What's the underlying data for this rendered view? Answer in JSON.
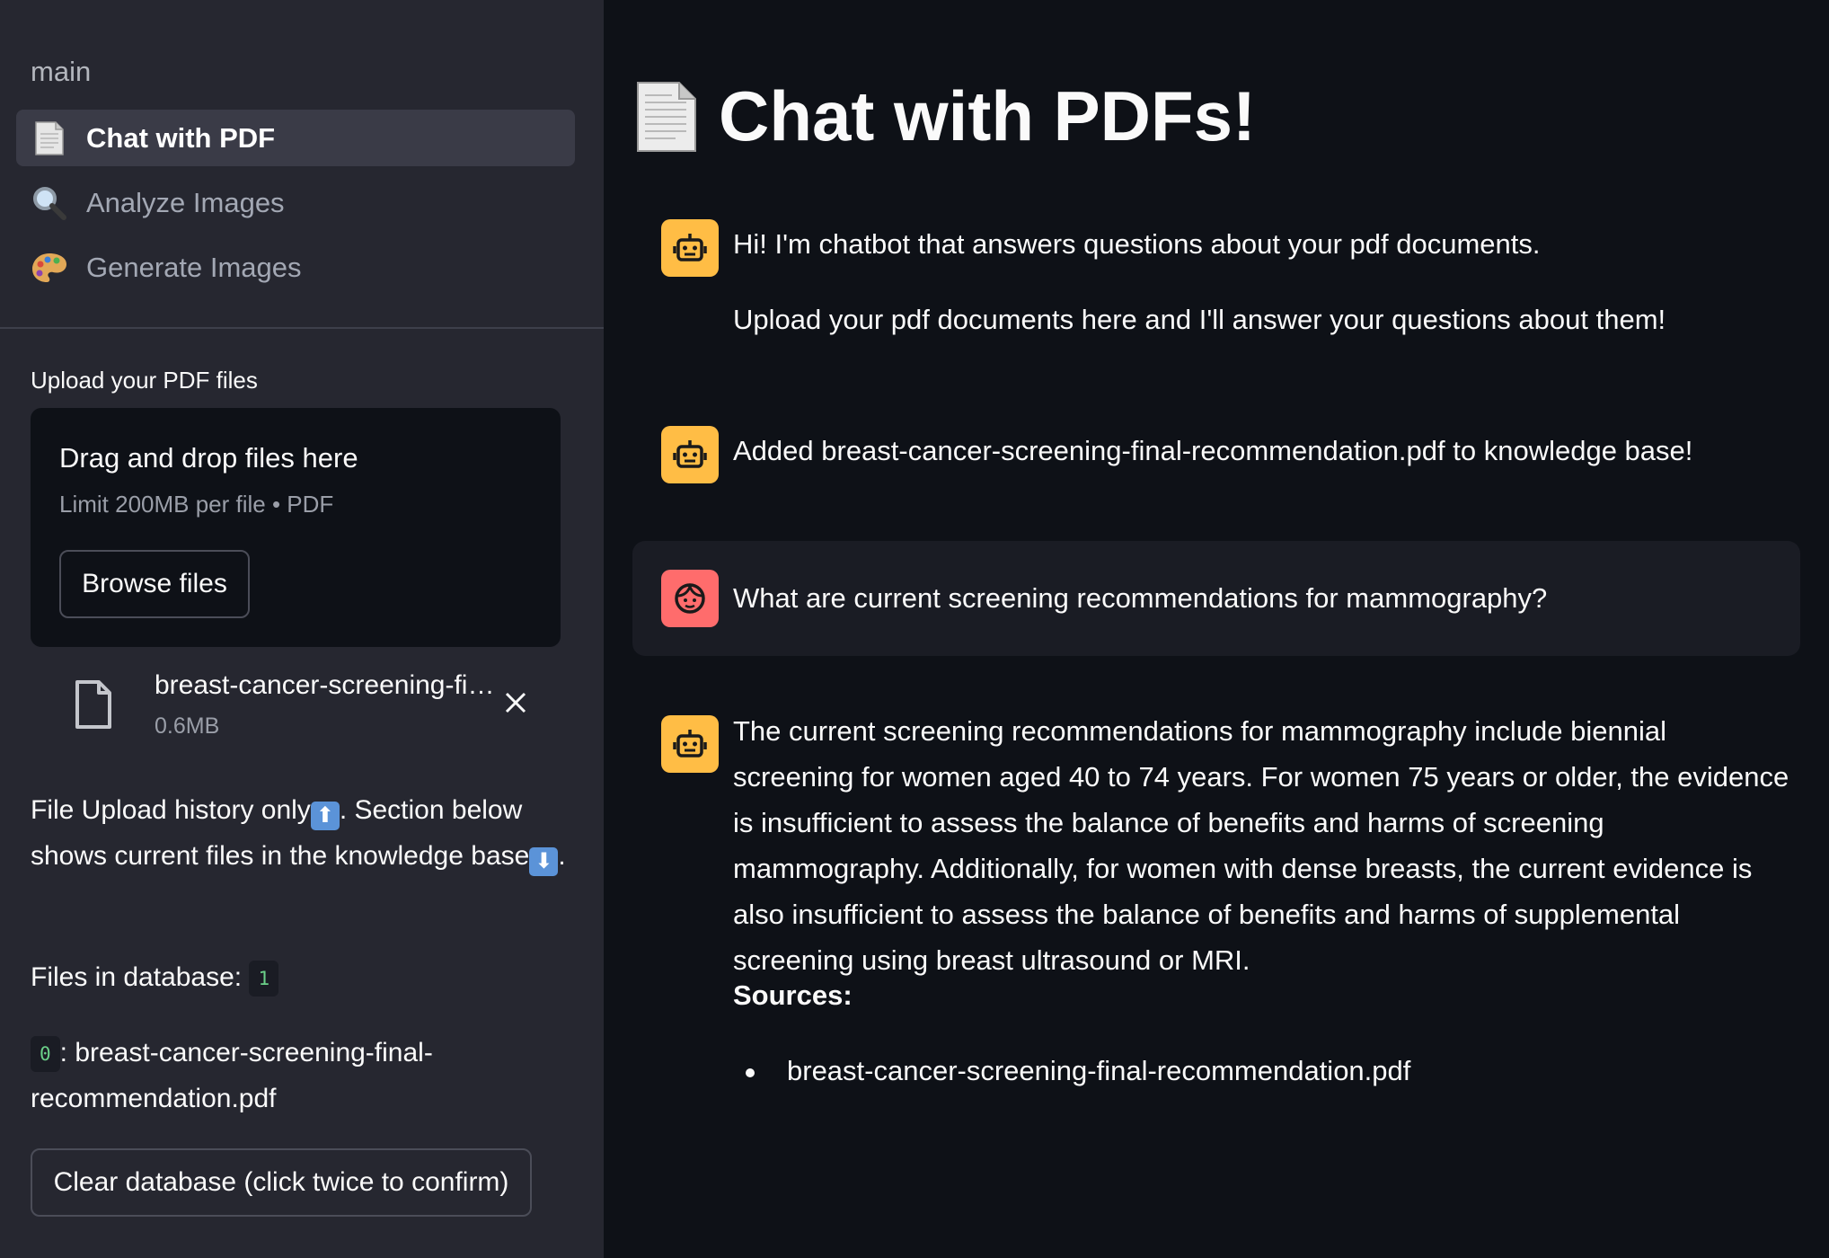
{
  "sidebar": {
    "nav_header": "main",
    "items": [
      {
        "label": "Chat with PDF",
        "icon": "page-icon"
      },
      {
        "label": "Analyze Images",
        "icon": "magnifier-icon"
      },
      {
        "label": "Generate Images",
        "icon": "palette-icon"
      }
    ],
    "upload": {
      "label": "Upload your PDF files",
      "drop_title": "Drag and drop files here",
      "limit": "Limit 200MB per file • PDF",
      "browse_label": "Browse files"
    },
    "uploaded_file": {
      "name": "breast-cancer-screening-fi…",
      "size": "0.6MB"
    },
    "history_note_1": "File Upload history only",
    "history_note_2": ". Section below shows current files in the knowledge base",
    "history_note_3": ".",
    "up_arrow": "⬆",
    "down_arrow": "⬇",
    "files_in_db_label": "Files in database:",
    "files_in_db_count": "1",
    "db_file_index": "0",
    "db_file_name": ": breast-cancer-screening-final-recommendation.pdf",
    "clear_label": "Clear database (click twice to confirm)"
  },
  "main": {
    "title": "Chat with PDFs!",
    "messages": [
      {
        "role": "assistant",
        "lines": [
          "Hi! I'm chatbot that answers questions about your pdf documents.",
          "Upload your pdf documents here and I'll answer your questions about them!"
        ]
      },
      {
        "role": "assistant",
        "text": "Added breast-cancer-screening-final-recommendation.pdf to knowledge base!"
      },
      {
        "role": "user",
        "text": "What are current screening recommendations for mammography?"
      },
      {
        "role": "assistant",
        "text": "The current screening recommendations for mammography include biennial screening for women aged 40 to 74 years. For women 75 years or older, the evidence is insufficient to assess the balance of benefits and harms of screening mammography. Additionally, for women with dense breasts, the current evidence is also insufficient to assess the balance of benefits and harms of supplemental screening using breast ultrasound or MRI.",
        "sources_label": "Sources:",
        "sources": [
          "breast-cancer-screening-final-recommendation.pdf"
        ]
      }
    ]
  },
  "colors": {
    "background": "#0e1117",
    "sidebar": "#262730",
    "bot_avatar": "#ffbd45",
    "user_avatar": "#ff6c6c",
    "code_green": "#6bd089"
  }
}
